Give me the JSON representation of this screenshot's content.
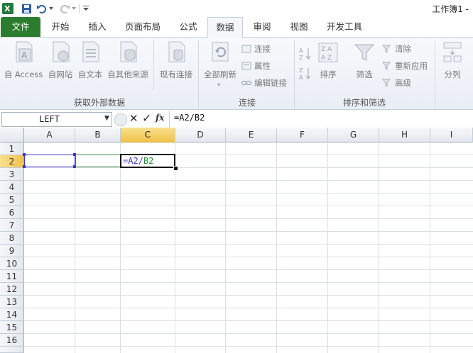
{
  "app": {
    "title": "工作簿1 -"
  },
  "quick_access": {
    "icons": [
      "excel-logo-icon",
      "save-icon",
      "undo-icon",
      "redo-icon",
      "customize-icon"
    ]
  },
  "tabs": [
    {
      "label": "文件"
    },
    {
      "label": "开始"
    },
    {
      "label": "插入"
    },
    {
      "label": "页面布局"
    },
    {
      "label": "公式"
    },
    {
      "label": "数据"
    },
    {
      "label": "审阅"
    },
    {
      "label": "视图"
    },
    {
      "label": "开发工具"
    }
  ],
  "active_tab": "数据",
  "ribbon": {
    "external": {
      "access": "自 Access",
      "web": "自网站",
      "text": "自文本",
      "other": "自其他来源",
      "existing": "现有连接",
      "group": "获取外部数据"
    },
    "connections": {
      "refresh_all": "全部刷新",
      "connections": "连接",
      "properties": "属性",
      "edit_links": "编辑链接",
      "group": "连接"
    },
    "sort_filter": {
      "sort": "排序",
      "filter": "筛选",
      "clear": "清除",
      "reapply": "重新应用",
      "advanced": "高级",
      "group": "排序和筛选"
    },
    "tools": {
      "text_to_columns": "分列"
    }
  },
  "formula_bar": {
    "name_box": "LEFT",
    "formula": "=A2/B2",
    "fx": "fx"
  },
  "grid": {
    "columns": [
      "A",
      "B",
      "C",
      "D",
      "E",
      "F",
      "G",
      "H",
      "I"
    ],
    "rows": [
      "1",
      "2",
      "3",
      "4",
      "5",
      "6",
      "7",
      "8",
      "9",
      "10",
      "11",
      "12",
      "13",
      "14",
      "15",
      "16"
    ],
    "active_cell": {
      "col": "C",
      "row": "2"
    },
    "editing_cell": {
      "prefix": "=A2/",
      "ref": "B2"
    }
  },
  "colors": {
    "file_tab": "#2b7c2f",
    "ref_blue": "#3a35c8",
    "ref_green": "#2e8b3a",
    "header_selected": "#f1c34a"
  }
}
